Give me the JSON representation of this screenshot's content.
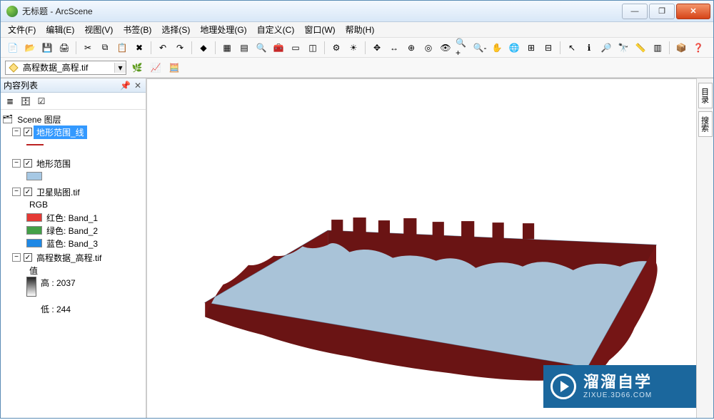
{
  "window": {
    "title": "无标题 - ArcScene"
  },
  "menu": {
    "file": "文件(F)",
    "edit": "编辑(E)",
    "view": "视图(V)",
    "bookmarks": "书签(B)",
    "selection": "选择(S)",
    "geoprocessing": "地理处理(G)",
    "customize": "自定义(C)",
    "window": "窗口(W)",
    "help": "帮助(H)"
  },
  "toolbar2": {
    "layerName": "高程数据_高程.tif"
  },
  "toc": {
    "title": "内容列表",
    "root": "Scene 图层",
    "layer1": {
      "name": "地形范围_线"
    },
    "layer2": {
      "name": "地形范围"
    },
    "layer3": {
      "name": "卫星贴图.tif",
      "rgbLabel": "RGB",
      "band1": "红色:   Band_1",
      "band2": "绿色: Band_2",
      "band3": "蓝色:   Band_3"
    },
    "layer4": {
      "name": "高程数据_高程.tif",
      "valueLabel": "值",
      "highLabel": "高 : 2037",
      "lowLabel": "低 : 244"
    }
  },
  "sidepanel": {
    "tab1": "目录",
    "tab2": "搜索"
  },
  "watermark": {
    "main": "溜溜自学",
    "sub": "ZIXUE.3D66.COM"
  }
}
